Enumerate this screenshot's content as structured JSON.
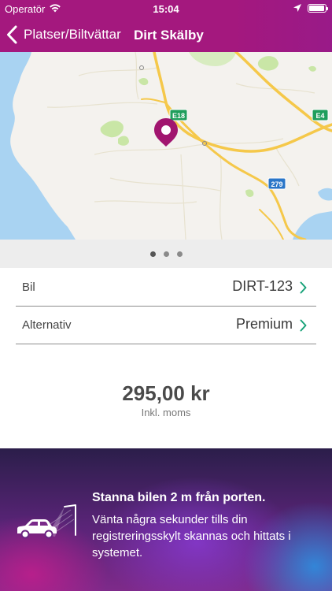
{
  "status_bar": {
    "carrier": "Operatör",
    "time": "15:04"
  },
  "nav": {
    "back_label": "Platser/Biltvättar",
    "title": "Dirt Skälby"
  },
  "map": {
    "road_labels": [
      "E18",
      "E4",
      "279"
    ]
  },
  "pager": {
    "count": 3,
    "active_index": 0
  },
  "rows": [
    {
      "label": "Bil",
      "value": "DIRT-123"
    },
    {
      "label": "Alternativ",
      "value": "Premium"
    }
  ],
  "price": {
    "amount": "295,00 kr",
    "note": "Inkl. moms"
  },
  "info": {
    "title": "Stanna bilen 2 m från porten.",
    "text": "Vänta några sekunder tills din registreringsskylt skannas och hittats i systemet."
  },
  "colors": {
    "brand": "#a4187e",
    "accent": "#1aa37a",
    "pin": "#a1156f",
    "water": "#a9d3f2",
    "road": "#f5c84a"
  }
}
